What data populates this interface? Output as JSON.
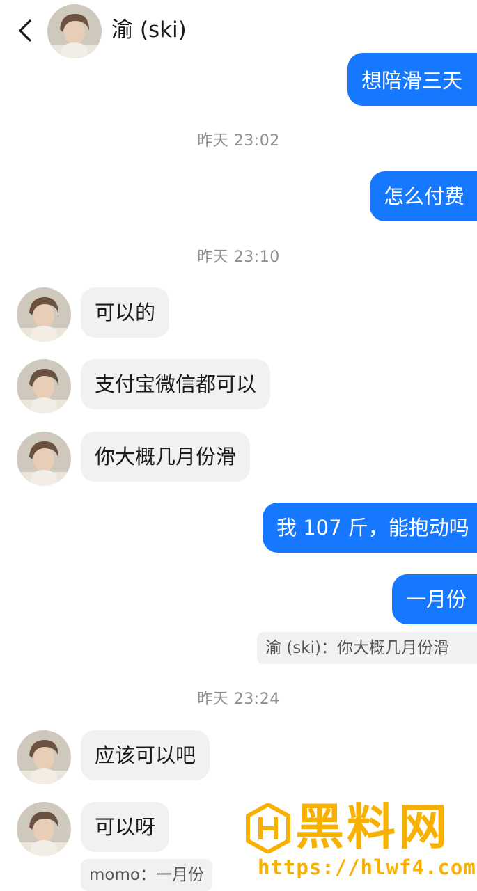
{
  "header": {
    "title": "渝 (ski)",
    "back_icon": "chevron-left-icon",
    "avatar_icon": "contact-avatar"
  },
  "colors": {
    "outgoing_bubble": "#1677ff",
    "incoming_bubble": "#f1f1f1",
    "timestamp": "#8e8e8e",
    "watermark": "#f8b100"
  },
  "messages": [
    {
      "direction": "out",
      "text": "想陪滑三天"
    },
    {
      "type": "timestamp",
      "text": "昨天 23:02"
    },
    {
      "direction": "out",
      "text": "怎么付费"
    },
    {
      "type": "timestamp",
      "text": "昨天 23:10"
    },
    {
      "direction": "in",
      "text": "可以的"
    },
    {
      "direction": "in",
      "text": "支付宝微信都可以"
    },
    {
      "direction": "in",
      "text": "你大概几月份滑"
    },
    {
      "direction": "out",
      "text": "我 107 斤，能抱动吗"
    },
    {
      "direction": "out",
      "text": "一月份"
    },
    {
      "type": "quote",
      "text": "渝 (ski)：你大概几月份滑"
    },
    {
      "type": "timestamp",
      "text": "昨天 23:24"
    },
    {
      "direction": "in",
      "text": "应该可以吧"
    },
    {
      "direction": "in",
      "text": "可以呀"
    },
    {
      "type": "quote",
      "text": "momo：一月份"
    }
  ],
  "watermark": {
    "title": "黑料网",
    "url": "https://hlwf4.com"
  }
}
